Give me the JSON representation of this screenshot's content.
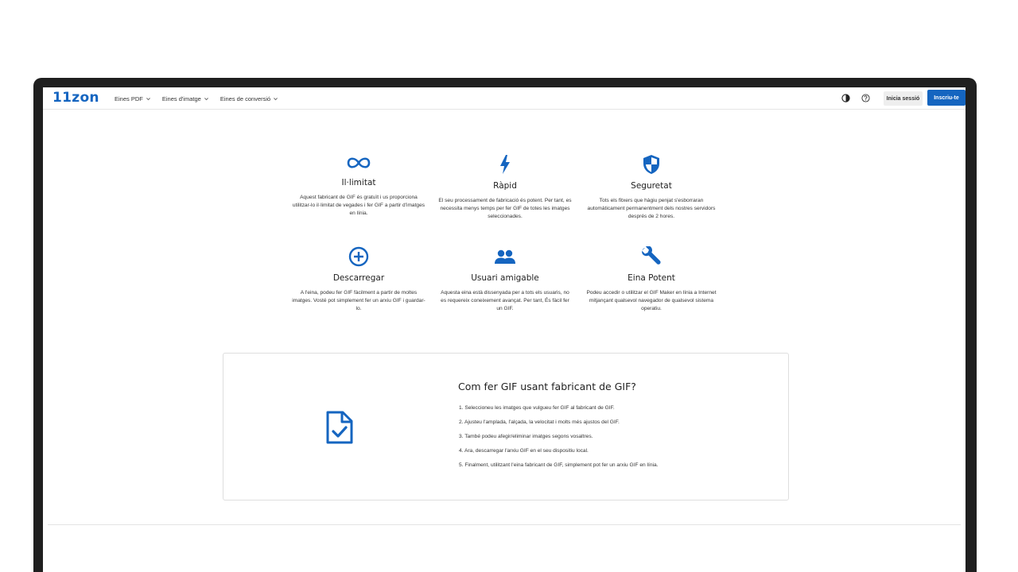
{
  "brand": {
    "logo": "11zon",
    "accent": "#1565c0"
  },
  "nav": {
    "items": [
      {
        "label": "Eines PDF"
      },
      {
        "label": "Eines d'imatge"
      },
      {
        "label": "Eines de conversió"
      }
    ],
    "login_label": "Inicia sessió",
    "signup_label": "Inscriu-te"
  },
  "features": [
    {
      "icon": "infinity-icon",
      "title": "Il·limitat",
      "text": "Aquest fabricant de GIF és gratuït i us proporciona utilitzar-lo il·limitat de vegades i fer GIF a partir d'imatges en línia."
    },
    {
      "icon": "bolt-icon",
      "title": "Ràpid",
      "text": "El seu processament de fabricació és potent. Per tant, es necessita menys temps per fer GIF de totes les imatges seleccionades."
    },
    {
      "icon": "shield-icon",
      "title": "Seguretat",
      "text": "Tots els fitxers que hàgiu penjat s'esborraran automàticament permanentment dels nostres servidors després de 2 hores."
    },
    {
      "icon": "plus-circle-icon",
      "title": "Descarregar",
      "text": "A l'eina, podeu fer GIF fàcilment a partir de moltes imatges. Vosté pot simplement fer un arxiu GIF i guardar-lo."
    },
    {
      "icon": "users-icon",
      "title": "Usuari amigable",
      "text": "Aquesta eina està dissenyada per a tots els usuaris, no es requereix coneixement avançat. Per tant, És fàcil fer un GIF."
    },
    {
      "icon": "wrench-icon",
      "title": "Eina Potent",
      "text": "Podeu accedir o utilitzar el GIF Maker en línia a Internet mitjançant qualsevol navegador de qualsevol sistema operatiu."
    }
  ],
  "howto": {
    "icon": "file-check-icon",
    "title": "Com fer GIF usant fabricant de GIF?",
    "steps": [
      "1. Seleccioneu les imatges que vulgueu fer GIF al fabricant de GIF.",
      "2. Ajusteu l'amplada, l'alçada, la velocitat i molts més ajustos del GIF.",
      "3. També podeu afegir/eliminar imatges segons vosaltres.",
      "4. Ara, descarregar l'arxiu GIF en el seu dispositiu local.",
      "5. Finalment, utilitzant l'eina fabricant de GIF, simplement pot fer un arxiu GIF en línia."
    ]
  }
}
